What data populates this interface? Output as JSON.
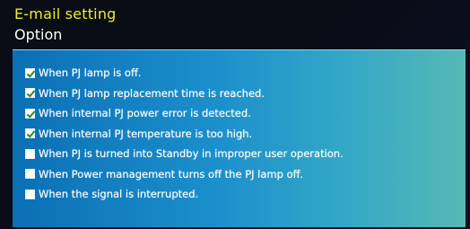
{
  "header": {
    "title": "E-mail setting",
    "subtitle": "Option"
  },
  "options": [
    {
      "label": "When PJ lamp is off.",
      "checked": true
    },
    {
      "label": "When PJ lamp replacement time is reached.",
      "checked": true
    },
    {
      "label": "When internal PJ power error is detected.",
      "checked": true
    },
    {
      "label": "When internal PJ temperature is too high.",
      "checked": true
    },
    {
      "label": "When PJ is turned into Standby in improper user operation.",
      "checked": false
    },
    {
      "label": "When Power management turns off the PJ lamp off.",
      "checked": false
    },
    {
      "label": "When the signal is interrupted.",
      "checked": false
    }
  ],
  "colors": {
    "title": "#e8ef2a",
    "check": "#2e8b2a"
  }
}
